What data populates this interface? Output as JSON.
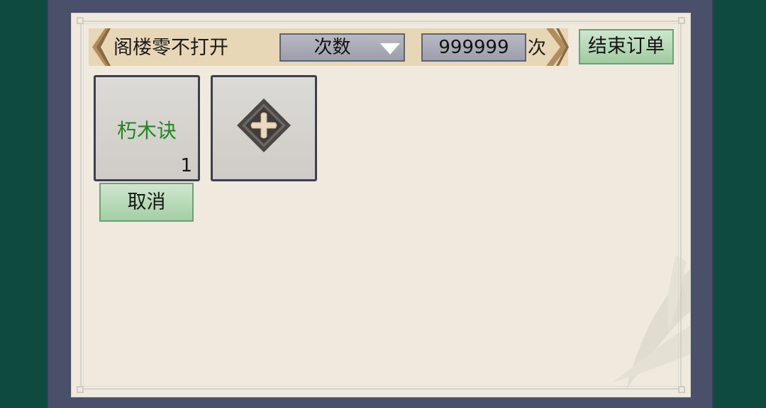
{
  "header": {
    "title": "阁楼零不打开",
    "mode_select": {
      "selected": "次数"
    },
    "count_value": "999999",
    "count_unit": "次",
    "end_order_label": "结束订单"
  },
  "slots": [
    {
      "name": "朽木诀",
      "count": "1"
    }
  ],
  "add_slot": {
    "icon": "plus-diamond-icon"
  },
  "cancel_label": "取消",
  "colors": {
    "background": "#0f4a3e",
    "frame": "#4a4f6a",
    "paper": "#efe9de",
    "header_bar": "#e8d7b7",
    "button_green": "#a3cfa3",
    "item_name_green": "#1e8a1e"
  }
}
